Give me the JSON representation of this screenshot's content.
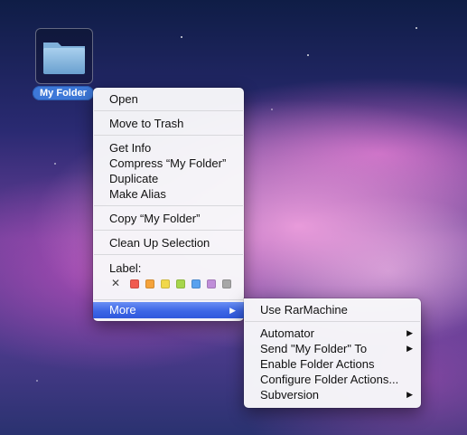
{
  "desktop_icon": {
    "label": "My Folder",
    "icon": "folder-icon"
  },
  "context_menu": {
    "items": [
      {
        "label": "Open"
      },
      {
        "label": "Move to Trash"
      },
      {
        "label": "Get Info"
      },
      {
        "label": "Compress “My Folder”"
      },
      {
        "label": "Duplicate"
      },
      {
        "label": "Make Alias"
      },
      {
        "label": "Copy “My Folder”"
      },
      {
        "label": "Clean Up Selection"
      },
      {
        "label": "More",
        "active": true,
        "has_submenu": true
      }
    ],
    "label_heading": "Label:",
    "label_none_symbol": "✕",
    "label_colors": [
      "#f05b4f",
      "#f5a33b",
      "#f1d84a",
      "#a7d64c",
      "#5aa2ef",
      "#c08ed9",
      "#a7a7a7"
    ],
    "submenu_arrow": "▶"
  },
  "submenu": {
    "items": [
      {
        "label": "Use RarMachine"
      },
      {
        "label": "Automator",
        "has_submenu": true
      },
      {
        "label": "Send \"My Folder\" To",
        "has_submenu": true
      },
      {
        "label": "Enable Folder Actions"
      },
      {
        "label": "Configure Folder Actions..."
      },
      {
        "label": "Subversion",
        "has_submenu": true
      }
    ]
  },
  "colors": {
    "selection": "#3d66e6",
    "label_badge": "#3d78d8"
  }
}
